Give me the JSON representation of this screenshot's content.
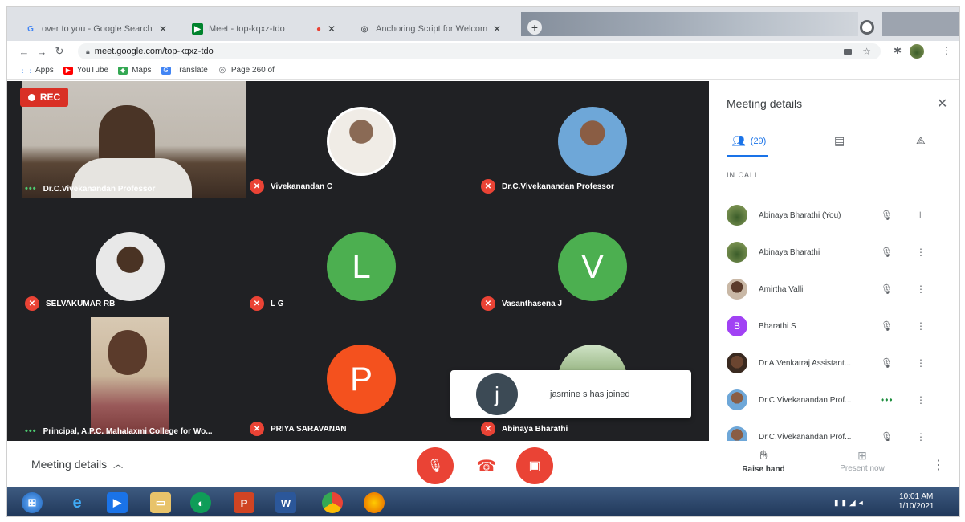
{
  "browser": {
    "tabs": [
      {
        "title": "over to you - Google Search",
        "icon": "google-icon",
        "active": false
      },
      {
        "title": "Meet - top-kqxz-tdo",
        "icon": "meet-icon",
        "active": true
      },
      {
        "title": "Anchoring Script for Welcoming",
        "icon": "web-icon",
        "active": false
      }
    ],
    "close_glyph": "✕",
    "new_tab_glyph": "+",
    "url": "meet.google.com/top-kqxz-tdo",
    "bookmarks": [
      {
        "label": "Apps",
        "icon": "apps-grid-icon",
        "color": "#1a73e8"
      },
      {
        "label": "YouTube",
        "icon": "youtube-icon",
        "color": "#ff0000"
      },
      {
        "label": "Maps",
        "icon": "maps-icon",
        "color": "#34a853"
      },
      {
        "label": "Translate",
        "icon": "translate-icon",
        "color": "#4285f4"
      },
      {
        "label": "Page 260 of",
        "icon": "web-icon",
        "color": "#5f6368"
      }
    ]
  },
  "meeting": {
    "rec_label": "REC",
    "toast_initial": "j",
    "toast_message": "jasmine s has joined",
    "tiles": [
      {
        "name": "Dr.C.Vivekanandan Professor",
        "status": "speaking"
      },
      {
        "name": "Vivekanandan C",
        "status": "muted"
      },
      {
        "name": "Dr.C.Vivekanandan Professor",
        "status": "muted"
      },
      {
        "name": "SELVAKUMAR RB",
        "status": "muted"
      },
      {
        "name": "L G",
        "status": "muted",
        "letter": "L"
      },
      {
        "name": "Vasanthasena J",
        "status": "muted",
        "letter": "V"
      },
      {
        "name": "Principal, A.P.C. Mahalaxmi College for Wo...",
        "status": "speaking"
      },
      {
        "name": "PRIYA SARAVANAN",
        "status": "muted",
        "letter": "P"
      },
      {
        "name": "Abinaya Bharathi",
        "status": "muted"
      }
    ],
    "controls": {
      "meeting_details": "Meeting details",
      "raise_hand": "Raise hand",
      "present_now": "Present now"
    }
  },
  "panel": {
    "title": "Meeting details",
    "people_count": "(29)",
    "in_call_label": "IN CALL",
    "participants": [
      {
        "name": "Abinaya Bharathi (You)",
        "avatar": "photo",
        "action": "pin-icon"
      },
      {
        "name": "Abinaya Bharathi",
        "avatar": "photo",
        "action": "more-vert-icon"
      },
      {
        "name": "Amirtha Valli",
        "avatar": "photo",
        "action": "more-vert-icon"
      },
      {
        "name": "Bharathi S",
        "avatar": "letter",
        "letter": "B",
        "action": "more-vert-icon"
      },
      {
        "name": "Dr.A.Venkatraj Assistant...",
        "avatar": "photo",
        "action": "more-vert-icon"
      },
      {
        "name": "Dr.C.Vivekanandan Prof...",
        "avatar": "photo",
        "action": "more-vert-icon",
        "speaking": true
      },
      {
        "name": "Dr.C.Vivekanandan Prof...",
        "avatar": "photo",
        "action": "more-vert-icon"
      }
    ]
  },
  "taskbar": {
    "time": "10:01 AM",
    "date": "1/10/2021"
  },
  "colors": {
    "meet_red": "#ea4335",
    "meet_blue": "#1a73e8",
    "avatar_green": "#4caf50",
    "avatar_orange": "#f4511e",
    "avatar_purple": "#a142f4",
    "stage_bg": "#202124"
  }
}
